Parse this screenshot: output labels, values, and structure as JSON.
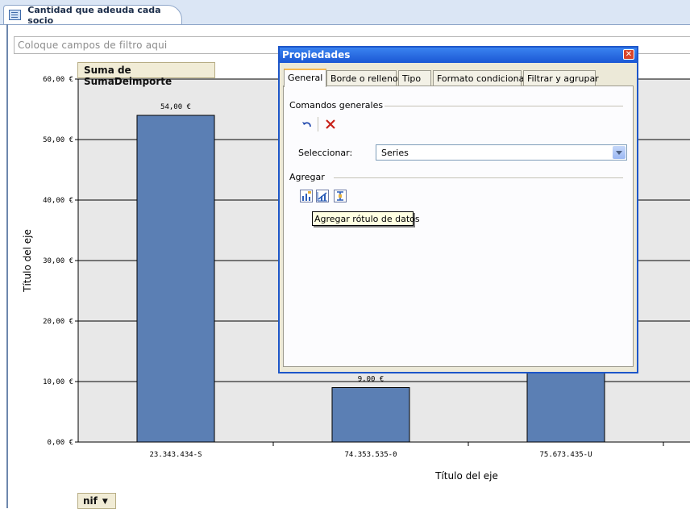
{
  "window": {
    "tab_title": "Cantidad que adeuda cada socio",
    "filter_placeholder": "Coloque campos de filtro aqui"
  },
  "fields": {
    "series_field": "Suma de SumaDeimporte",
    "category_field": "nif"
  },
  "dialog": {
    "title": "Propiedades",
    "tabs": [
      "General",
      "Borde o relleno",
      "Tipo",
      "Formato condicional",
      "Filtrar y agrupar"
    ],
    "active_tab": "General",
    "section_commands": "Comandos generales",
    "select_label": "Seleccionar:",
    "select_value": "Series",
    "section_add": "Agregar",
    "tooltip": "Agregar rótulo de datos",
    "icons": [
      "undo-icon",
      "delete-icon",
      "add-data-label-icon",
      "add-trendline-icon",
      "add-error-bars-icon"
    ]
  },
  "chart_data": {
    "type": "bar",
    "categories": [
      "23.343.434-S",
      "74.353.535-0",
      "75.673.435-U"
    ],
    "values": [
      54,
      9,
      14.5
    ],
    "data_labels": [
      "54,00 €",
      "9,00 €",
      ""
    ],
    "ylim": [
      0,
      60
    ],
    "yticks": [
      "0,00 €",
      "10,00 €",
      "20,00 €",
      "30,00 €",
      "40,00 €",
      "50,00 €",
      "60,00 €"
    ],
    "xlabel": "Título del eje",
    "ylabel": "Título del eje",
    "grid": true,
    "colors": {
      "bar": "#5b7fb4",
      "plot_background": "#e8e8e8",
      "gridline": "#000000"
    }
  }
}
